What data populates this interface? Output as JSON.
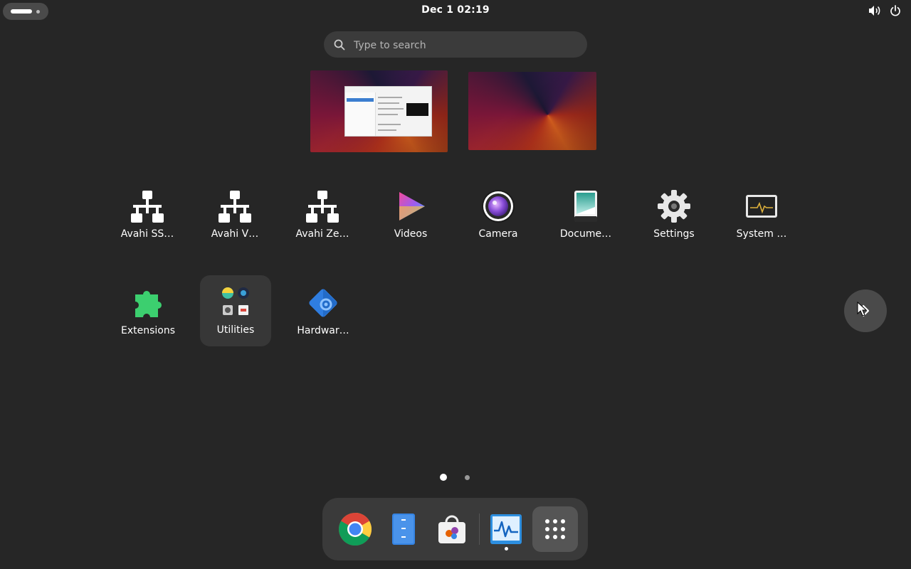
{
  "topbar": {
    "clock": "Dec 1  02:19",
    "tray_icons": [
      "volume-icon",
      "power-icon"
    ]
  },
  "search": {
    "placeholder": "Type to search"
  },
  "workspaces": [
    {
      "name": "workspace-1",
      "has_window": true
    },
    {
      "name": "workspace-2",
      "has_window": false
    }
  ],
  "apps": [
    {
      "label": "Avahi SS…",
      "icon": "network-icon"
    },
    {
      "label": "Avahi V…",
      "icon": "network-icon"
    },
    {
      "label": "Avahi Ze…",
      "icon": "network-icon"
    },
    {
      "label": "Videos",
      "icon": "videos-icon"
    },
    {
      "label": "Camera",
      "icon": "camera-icon"
    },
    {
      "label": "Docume…",
      "icon": "document-viewer-icon"
    },
    {
      "label": "Settings",
      "icon": "gear-icon"
    },
    {
      "label": "System …",
      "icon": "system-monitor-icon"
    },
    {
      "label": "Extensions",
      "icon": "puzzle-icon"
    },
    {
      "label": "Utilities",
      "icon": "folder-grid-icon"
    },
    {
      "label": "Hardwar…",
      "icon": "hardware-icon"
    }
  ],
  "pages": {
    "current": 1,
    "total": 2
  },
  "dock": [
    {
      "name": "chrome",
      "icon": "chrome-icon"
    },
    {
      "name": "files",
      "icon": "files-icon"
    },
    {
      "name": "software",
      "icon": "software-store-icon"
    },
    {
      "name": "system-monitor",
      "icon": "system-monitor-icon",
      "running": true
    },
    {
      "name": "show-apps",
      "icon": "apps-grid-icon",
      "active": true
    }
  ],
  "colors": {
    "background": "#262626",
    "panel": "#3a3a3a",
    "accent": "#3584e4"
  }
}
